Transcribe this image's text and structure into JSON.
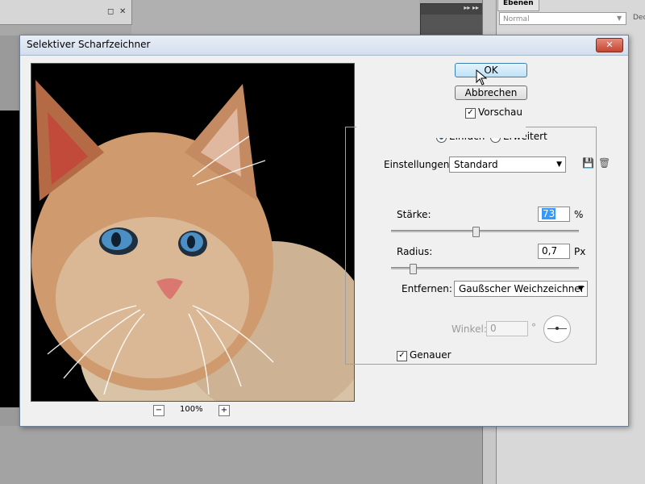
{
  "background": {
    "layers_tab": "Ebenen",
    "blend_mode": "Normal",
    "opacity_label": "Deck"
  },
  "dialog": {
    "title": "Selektiver Scharfzeichner",
    "close_label": "✕",
    "ok_label": "OK",
    "cancel_label": "Abbrechen",
    "preview_label": "Vorschau",
    "preview_checked": true,
    "mode_basic": "Einfach",
    "mode_advanced": "Erweitert",
    "mode_selected": "Einfach",
    "zoom_value": "100%",
    "zoom_out": "−",
    "zoom_in": "+",
    "settings_label": "Einstellungen:",
    "settings_value": "Standard",
    "amount_label": "Stärke:",
    "amount_value": "73",
    "amount_unit": "%",
    "amount_slider_fraction": 0.45,
    "radius_label": "Radius:",
    "radius_value": "0,7",
    "radius_unit": "Px",
    "radius_slider_fraction": 0.1,
    "remove_label": "Entfernen:",
    "remove_value": "Gaußscher Weichzeichner",
    "angle_label": "Winkel:",
    "angle_value": "0",
    "angle_unit": "°",
    "more_accurate_label": "Genauer",
    "more_accurate_checked": true
  }
}
